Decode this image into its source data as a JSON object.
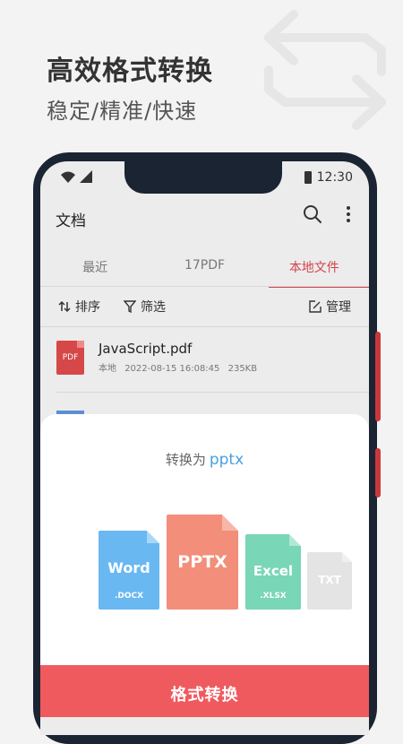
{
  "hero": {
    "title": "高效格式转换",
    "subtitle": "稳定/精准/快速"
  },
  "status": {
    "time": "12:30"
  },
  "appbar": {
    "title": "文档"
  },
  "tabs": [
    {
      "label": "最近"
    },
    {
      "label": "17PDF"
    },
    {
      "label": "本地文件",
      "active": true
    }
  ],
  "toolbar": {
    "sort_label": "排序",
    "filter_label": "筛选",
    "manage_label": "管理"
  },
  "file": {
    "icon_label": "PDF",
    "name": "JavaScript.pdf",
    "location": "本地",
    "date": "2022-08-15 16:08:45",
    "size": "235KB"
  },
  "sheet": {
    "prefix": "转换为",
    "target_format": "pptx",
    "formats": [
      {
        "name": "Word",
        "ext": ".DOCX",
        "color": "#6ab8f2"
      },
      {
        "name": "PPTX",
        "ext": "",
        "color": "#f28e79"
      },
      {
        "name": "Excel",
        "ext": ".XLSX",
        "color": "#79d6b7"
      },
      {
        "name": "TXT",
        "ext": "",
        "color": "#e4e4e4"
      }
    ],
    "convert_label": "格式转换"
  },
  "colors": {
    "accent": "#ef5a5e",
    "tab_active": "#d4434a",
    "link": "#4a9fde"
  }
}
